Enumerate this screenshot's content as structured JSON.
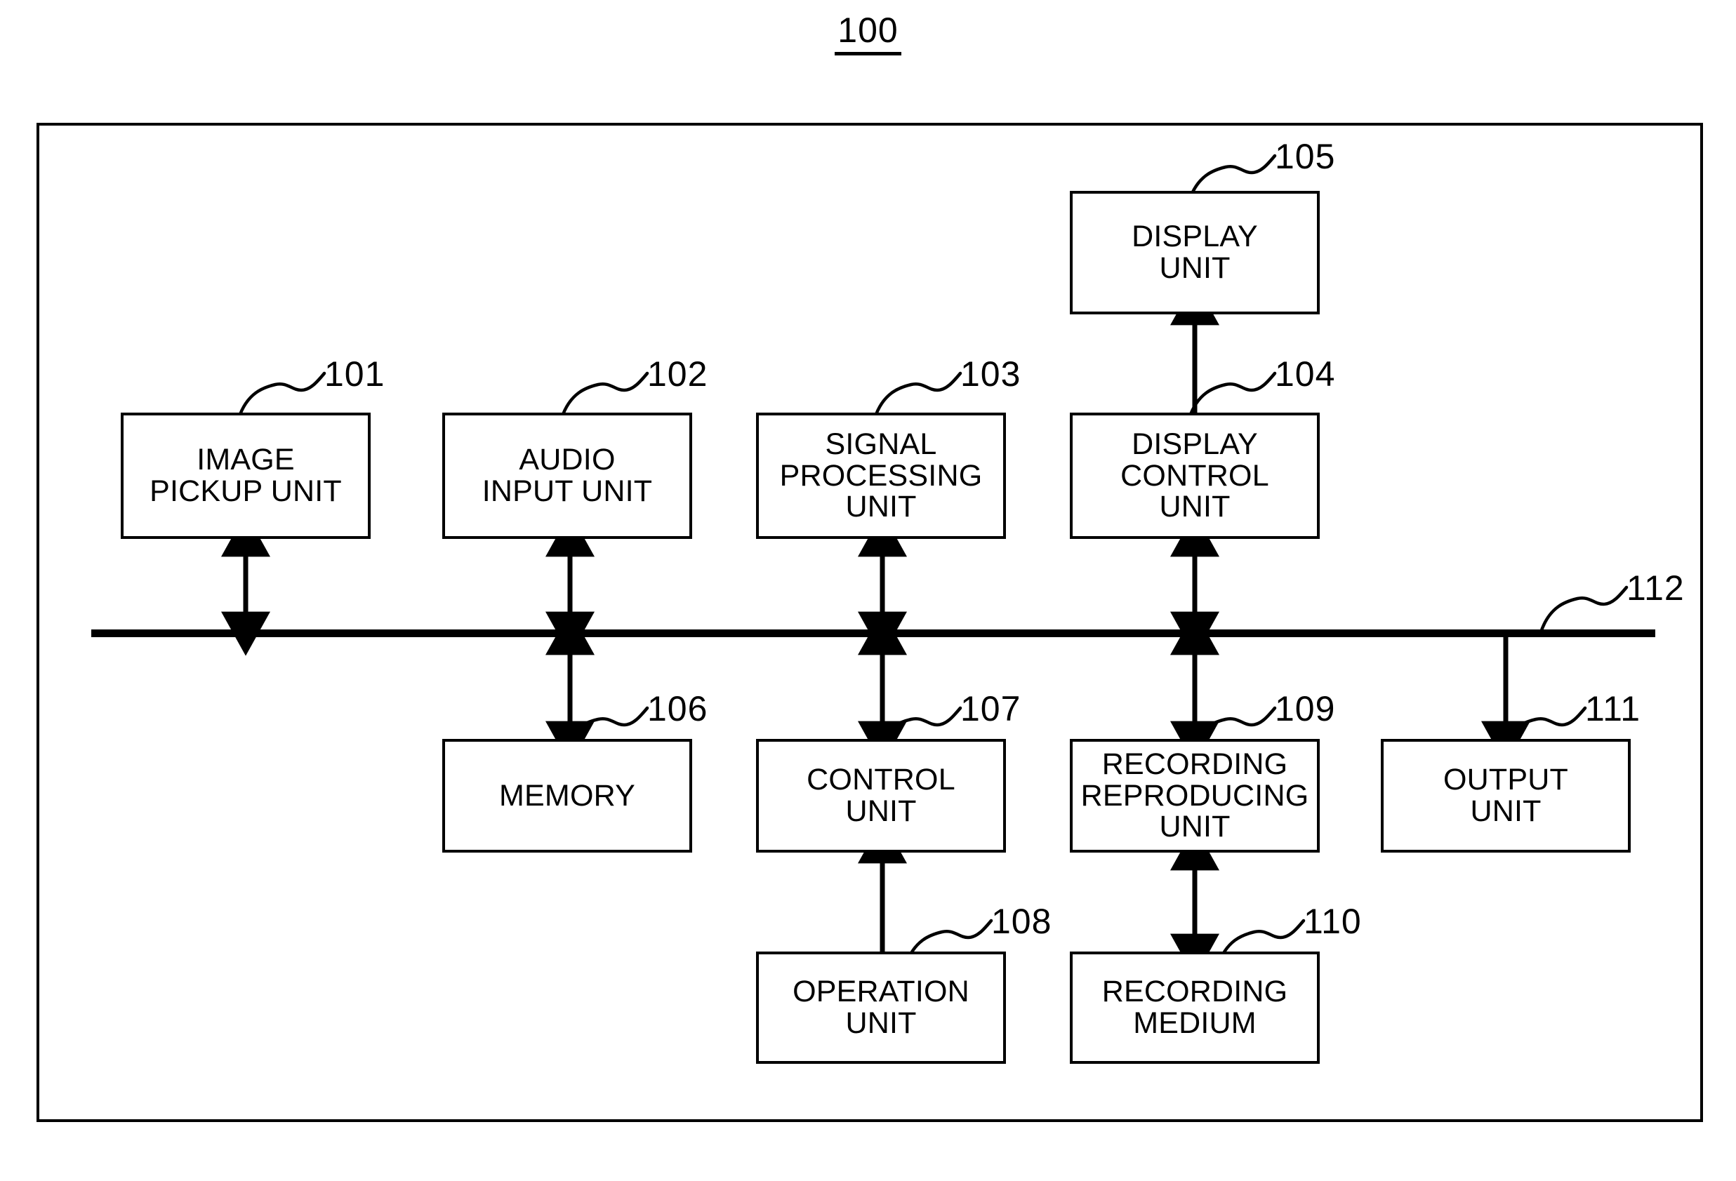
{
  "figure": {
    "title_number": "100",
    "bus": {
      "ref": "112",
      "name": "system-bus"
    }
  },
  "blocks": [
    {
      "id": "101",
      "label": "IMAGE\nPICKUP UNIT",
      "name": "image-pickup-unit"
    },
    {
      "id": "102",
      "label": "AUDIO\nINPUT UNIT",
      "name": "audio-input-unit"
    },
    {
      "id": "103",
      "label": "SIGNAL\nPROCESSING\nUNIT",
      "name": "signal-processing-unit"
    },
    {
      "id": "104",
      "label": "DISPLAY\nCONTROL\nUNIT",
      "name": "display-control-unit"
    },
    {
      "id": "105",
      "label": "DISPLAY\nUNIT",
      "name": "display-unit"
    },
    {
      "id": "106",
      "label": "MEMORY",
      "name": "memory"
    },
    {
      "id": "107",
      "label": "CONTROL\nUNIT",
      "name": "control-unit"
    },
    {
      "id": "108",
      "label": "OPERATION\nUNIT",
      "name": "operation-unit"
    },
    {
      "id": "109",
      "label": "RECORDING\nREPRODUCING\nUNIT",
      "name": "recording-reproducing-unit"
    },
    {
      "id": "110",
      "label": "RECORDING\nMEDIUM",
      "name": "recording-medium"
    },
    {
      "id": "111",
      "label": "OUTPUT\nUNIT",
      "name": "output-unit"
    }
  ],
  "connections": [
    {
      "from": "101",
      "to": "112",
      "type": "bidirectional"
    },
    {
      "from": "102",
      "to": "112",
      "type": "bidirectional"
    },
    {
      "from": "103",
      "to": "112",
      "type": "bidirectional"
    },
    {
      "from": "104",
      "to": "112",
      "type": "bidirectional"
    },
    {
      "from": "104",
      "to": "105",
      "type": "unidirectional"
    },
    {
      "from": "112",
      "to": "106",
      "type": "bidirectional"
    },
    {
      "from": "112",
      "to": "107",
      "type": "bidirectional"
    },
    {
      "from": "112",
      "to": "109",
      "type": "bidirectional"
    },
    {
      "from": "112",
      "to": "111",
      "type": "unidirectional"
    },
    {
      "from": "108",
      "to": "107",
      "type": "unidirectional"
    },
    {
      "from": "109",
      "to": "110",
      "type": "bidirectional"
    }
  ],
  "colors": {
    "stroke": "#000000",
    "background": "#ffffff"
  }
}
